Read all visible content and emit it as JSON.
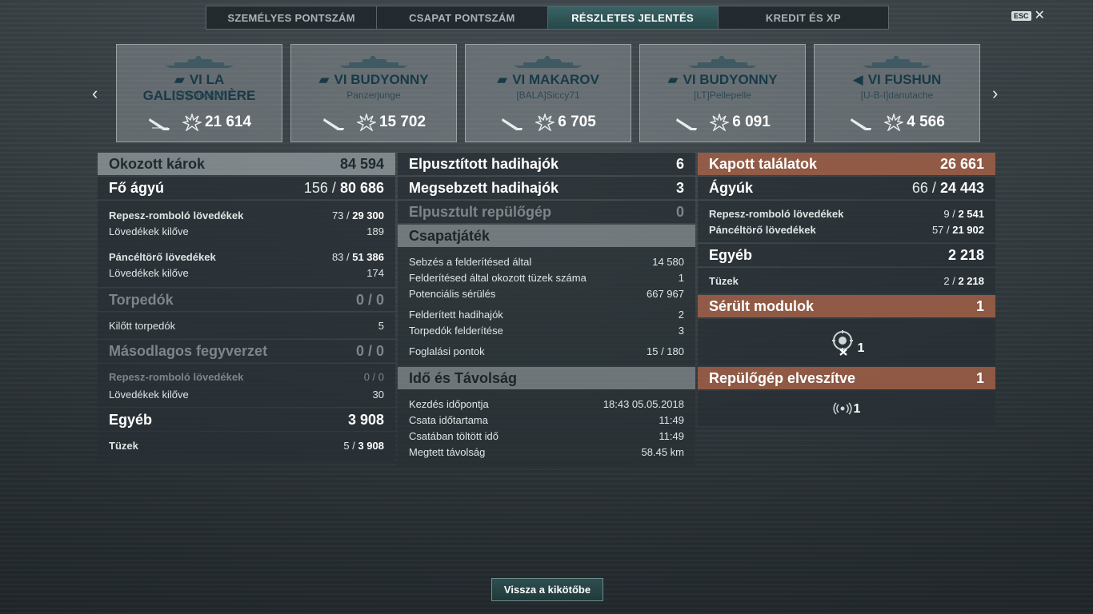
{
  "tabs": [
    "SZEMÉLYES PONTSZÁM",
    "CSAPAT PONTSZÁM",
    "RÉSZLETES JELENTÉS",
    "KREDIT ÉS XP"
  ],
  "active_tab": 2,
  "esc": {
    "key": "ESC",
    "close": "✕"
  },
  "nav": {
    "prev": "‹",
    "next": "›"
  },
  "ships": [
    {
      "name": "VI LA GALISSONNIÈRE",
      "player": "[LT]Orock87",
      "damage": "21 614"
    },
    {
      "name": "VI BUDYONNY",
      "player": "Panzerjunge",
      "damage": "15 702"
    },
    {
      "name": "VI MAKAROV",
      "player": "[BALA]Siccy71",
      "damage": "6 705"
    },
    {
      "name": "VI BUDYONNY",
      "player": "[LT]Pellepelle",
      "damage": "6 091"
    },
    {
      "name": "VI FUSHUN",
      "player": "[U-B-I]danutache",
      "damage": "4 566"
    }
  ],
  "left": {
    "dealt": {
      "label": "Okozott károk",
      "value": "84 594"
    },
    "main": {
      "label": "Fő ágyú",
      "hits": "156 / ",
      "dmg": "80 686"
    },
    "he": {
      "label": "Repesz-romboló lövedékek",
      "hits": "73 / ",
      "dmg": "29 300"
    },
    "he_fired": {
      "label": "Lövedékek kilőve",
      "value": "189"
    },
    "ap": {
      "label": "Páncéltörő lövedékek",
      "hits": "83 / ",
      "dmg": "51 386"
    },
    "ap_fired": {
      "label": "Lövedékek kilőve",
      "value": "174"
    },
    "torp": {
      "label": "Torpedók",
      "value": "0 / 0"
    },
    "torp_fired": {
      "label": "Kilőtt torpedók",
      "value": "5"
    },
    "sec": {
      "label": "Másodlagos fegyverzet",
      "value": "0 / 0"
    },
    "sec_he": {
      "label": "Repesz-romboló lövedékek",
      "value": "0 / 0"
    },
    "sec_fired": {
      "label": "Lövedékek kilőve",
      "value": "30"
    },
    "other": {
      "label": "Egyéb",
      "value": "3 908"
    },
    "fires": {
      "label": "Tüzek",
      "hits": "5 / ",
      "dmg": "3 908"
    }
  },
  "center": {
    "destroyed": {
      "label": "Elpusztított hadihajók",
      "value": "6"
    },
    "damaged": {
      "label": "Megsebzett hadihajók",
      "value": "3"
    },
    "planes": {
      "label": "Elpusztult repülőgép",
      "value": "0"
    },
    "team": {
      "title": "Csapatjáték",
      "rows": [
        {
          "label": "Sebzés a felderítésed által",
          "value": "14 580"
        },
        {
          "label": "Felderítésed által okozott tüzek száma",
          "value": "1"
        },
        {
          "label": "Potenciális sérülés",
          "value": "667 967"
        },
        {
          "label": "Felderített hadihajók",
          "value": "2"
        },
        {
          "label": "Torpedók felderítése",
          "value": "3"
        },
        {
          "label": "Foglalási pontok",
          "value": "15 / 180"
        }
      ]
    },
    "time": {
      "title": "Idő és Távolság",
      "rows": [
        {
          "label": "Kezdés időpontja",
          "value": "18:43  05.05.2018"
        },
        {
          "label": "Csata időtartama",
          "value": "11:49"
        },
        {
          "label": "Csatában töltött idő",
          "value": "11:49"
        },
        {
          "label": "Megtett távolság",
          "value": "58.45 km"
        }
      ]
    }
  },
  "right": {
    "received": {
      "label": "Kapott találatok",
      "value": "26 661"
    },
    "guns": {
      "label": "Ágyúk",
      "hits": "66 / ",
      "dmg": "24 443"
    },
    "he": {
      "label": "Repesz-romboló lövedékek",
      "hits": "9 / ",
      "dmg": "2 541"
    },
    "ap": {
      "label": "Páncéltörő lövedékek",
      "hits": "57 / ",
      "dmg": "21 902"
    },
    "other": {
      "label": "Egyéb",
      "value": "2 218"
    },
    "fires": {
      "label": "Tüzek",
      "hits": "2 / ",
      "dmg": "2 218"
    },
    "modules": {
      "label": "Sérült modulok",
      "value": "1",
      "icon_count": "1"
    },
    "planes_lost": {
      "label": "Repülőgép elveszítve",
      "value": "1",
      "icon_count": "1"
    }
  },
  "back_button": "Vissza a kikötőbe"
}
